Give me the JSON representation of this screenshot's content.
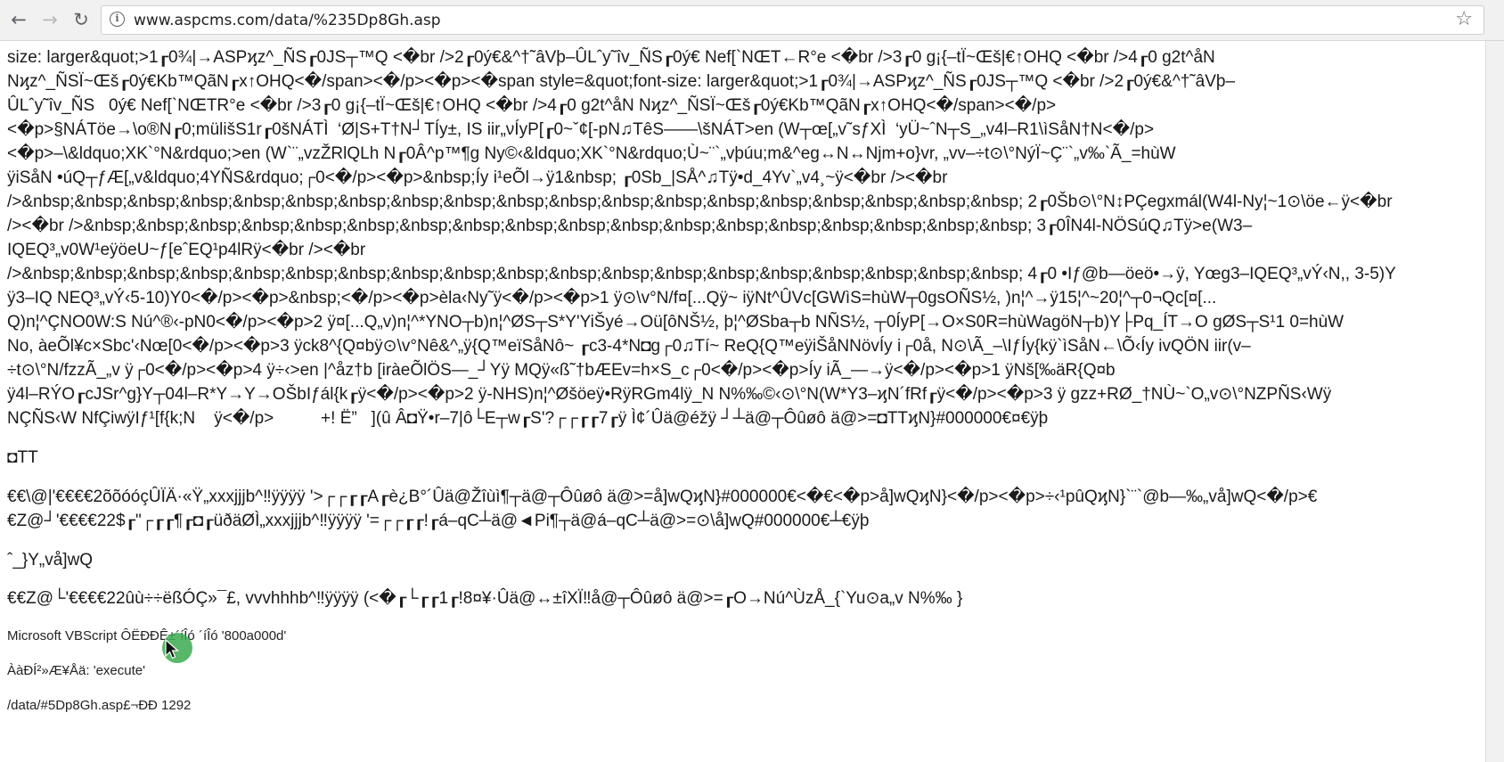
{
  "browser": {
    "url": "www.aspcms.com/data/%235Dp8Gh.asp",
    "back_icon": "←",
    "forward_icon": "→",
    "reload_icon": "↻",
    "star_icon": "☆",
    "info_icon": "i"
  },
  "content": {
    "block1_lines": [
      "size: larger&quot;>1┎0¾|→ASPϗz^_ÑS┎0JS┬™Q <�br />2┎0ý€&^†˜âVþ–ÛLˆy˜îv_ÑS┎0ý€ Nef[`NŒT←R°e <�br />3┎0 g¡{–tÏ~Œš|€↑OHQ <�br />4┎0 g2t^åN",
      "Nϗz^_ÑSÏ~Œš┎0ý€Kb™QãN┎x↑OHQ<�/span><�/p><�p><�span style=&quot;font-size: larger&quot;>1┎0¾|→ASPϗz^_ÑS┎0JS┬™Q <�br />2┎0ý€&^†˜âVþ–",
      "ÛLˆy˜îv_ÑS   0ý€ Nef[`NŒTR°e <�br />3┎0 g¡{–tÏ~Œš|€↑OHQ <�br />4┎0 g2t^åN Nϗz^_ÑSÏ~Œš┎0ý€Kb™QãN┎x↑OHQ<�/span><�/p>",
      "<�p>§NÁTöe→\\o®N┎0;mülišS1r┎0šNÁTÌ  ‘Ø|S+T†N┘TÍy±, IS iir„νÍyP[┎0~ˇ¢[-pN♫TêS——\\šNÁT>en (W┬œ[„v˜sƒXÌ  ‘yÜ~ˆN┬S_„v4l–R1\\ìSåN†N<�/p>",
      "<�p>–\\&ldquo;XK`°N&rdquo;>en (W`¨„vzŽRlQLh N┎0Â^p™¶g Ny©‹&ldquo;XK`°N&rdquo;Ù~¨`„vþúu;m&^eg↔N↔Njm+o}vr, „vv–÷t⊙\\°NýÏ~Ç¨`„v‰`Ã_=hùW",
      "ÿiSåN •úQ┬ƒÆ[„v&ldquo;4YÑS&rdquo;┌0<�/p><�p>&nbsp;Íy i¹eÕl→ÿ1&nbsp; ┎0Sb_|SÅ^♫Tÿ•d_4Yv`„v4¸~ÿ<�br /><�br",
      "/>&nbsp;&nbsp;&nbsp;&nbsp;&nbsp;&nbsp;&nbsp;&nbsp;&nbsp;&nbsp;&nbsp;&nbsp;&nbsp;&nbsp;&nbsp;&nbsp;&nbsp;&nbsp;&nbsp; 2┎0Šb⊙\\°N↕PÇegxmál(W4l-Ny¦~1⊙\\öe←ÿ<�br",
      "/><�br />&nbsp;&nbsp;&nbsp;&nbsp;&nbsp;&nbsp;&nbsp;&nbsp;&nbsp;&nbsp;&nbsp;&nbsp;&nbsp;&nbsp;&nbsp;&nbsp;&nbsp;&nbsp; 3┎0ÎN4l-NÖSúQ♫Tÿ>e(W3–",
      "IQEQ³„v0W¹eÿöeU~ƒ[eˆEQ¹p4lRÿ<�br /><�br",
      "/>&nbsp;&nbsp;&nbsp;&nbsp;&nbsp;&nbsp;&nbsp;&nbsp;&nbsp;&nbsp;&nbsp;&nbsp;&nbsp;&nbsp;&nbsp;&nbsp;&nbsp;&nbsp;&nbsp; 4┎0 •Iƒ@b—öeö•→ÿ, Yœg3–IQEQ³„vÝ‹N,, 3-5)Y",
      "ÿ3–IQ NEQ³„vÝ‹5-10)Y0<�/p><�p>&nbsp;<�/p><�p>èla‹Ny˜ÿ<�/p><�p>1 ÿ⊙\\v°N/f¤[...Qÿ~ iÿNt^ÛVc[GWìS=hùW┬0gsOÑS½, )n¦^→ÿ15¦^~20¦^┬0¬Qc[¤[...",
      "Q)n¦^ÇNO0W:S Nú^®‹-pN0<�/p><�p>2 ÿ¤[...Q„v)n¦^*YNO┬b)n¦^ØS┬S*Y'YiŠyé→Oü[ôNŠ½, þ¦^ØSba┬b NÑS½, ┬0ÍyP[→O×S0R=hùWagöN┬b)Y├Pq_ÍT→O gØS┬S¹1 0=hùW",
      "No, àeÕl¥c×Sbc'‹Nœ[0<�/p><�p>3 ÿck8^{Q¤bÿ⊙\\v°Nê&^„ÿ{Q™eïSåNô~ ┎c3-4*N◘g┌0♫Tí~ ReQ{Q™eÿiŠåNNövÍy i┌0å, N⊙\\Ã_–\\IƒÍy{kÿ`ìSåN←\\Õ‹Íy ivQÖN iir(v–",
      "÷t⊙\\°N/fzzÃ_„v ÿ┌0<�/p><�p>4 ÿ÷‹>en |^åz†b [iràeÕlÖS—_┘Yÿ MQÿ«ß˜†bÆEv=h×S_c┌0<�/p><�p>Íy iÃ_—→ÿ<�/p><�p>1 ÿNš[‰äR{Q¤b",
      "ÿ4l–RÝO┎cJSr^g}Y┬04l–R*Y→Y→OŠbIƒál{k┎ÿ<�/p><�p>2 ÿ-NHS)n¦^Øšöeÿ•RÿRGm4lÿ_N N%‰©‹⊙\\°N(W*Y3–ϗN´fRf┎ÿ<�/p><�p>3 ÿ gzz+RØ_†NÙ~`O„v⊙\\°NZPÑS‹Wÿ",
      "NÇÑS‹W NfÇiwÿIƒ¹[f{k;N    ÿ<�/p>          +! Ë”   ](û Â◘Ÿ•r–7|ô└E┬w┎S'?┌┌┎┎7┎ÿ Ì¢´Ûä@éžÿ ┘┴ä@┬Ôûøô ä@>=◘TTϗN}#000000€¤€ÿþ"
    ],
    "block2": "◘TT",
    "block3_lines": [
      "€€\\@|'€€€€2õõóóçÛÏÄ·«Ÿ„xxxjjjb^‼ÿÿÿÿ '>┌┌┎┎A┎è¿B°´Ûä@Žîùì¶┬ä@┬Ôûøô ä@>=å]wQϗN}#000000€<�€<�p>å]wQϗN}<�/p><�p>÷‹¹pûQϗN}`¨`@b—‰„vå]wQ<�/p>€",
      "€Z@┘'€€€€22$┎\"┌┎┎¶┎◘┎üðäØÌ„xxxjjjb^‼ÿÿÿÿ '=┌┌┎┎!┎á–qC┴ä@◄Pi¶┬ä@á–qC┴ä@>=⊙\\å]wQ#000000€┴€ÿþ"
    ],
    "block4": "ˆ_}Y„vå]wQ",
    "block5": "€€Z@└'€€€€22ûù÷÷ëßÓÇ»¯£, vvvhhhb^‼ÿÿÿÿ (<�┎└┎┎1┎!8¤¥·Ûä@↔±îXÏ‼å@┬Ôûøô ä@>=┎O→Nú^ÙzÅ_{`Yu⊙a„v N%‰ }",
    "error_title": "Microsoft VBScript ÔËÐÐÊ±´íÎó ´íÎó '800a000d'",
    "error_type": "ÀàÐÍ²»Æ¥Åä: 'execute'",
    "error_location": "/data/#5Dp8Gh.asp£¬ÐÐ 1292"
  },
  "colors": {
    "toolbar_bg": "#f1f1f1",
    "cursor_highlight": "#3caa50"
  }
}
